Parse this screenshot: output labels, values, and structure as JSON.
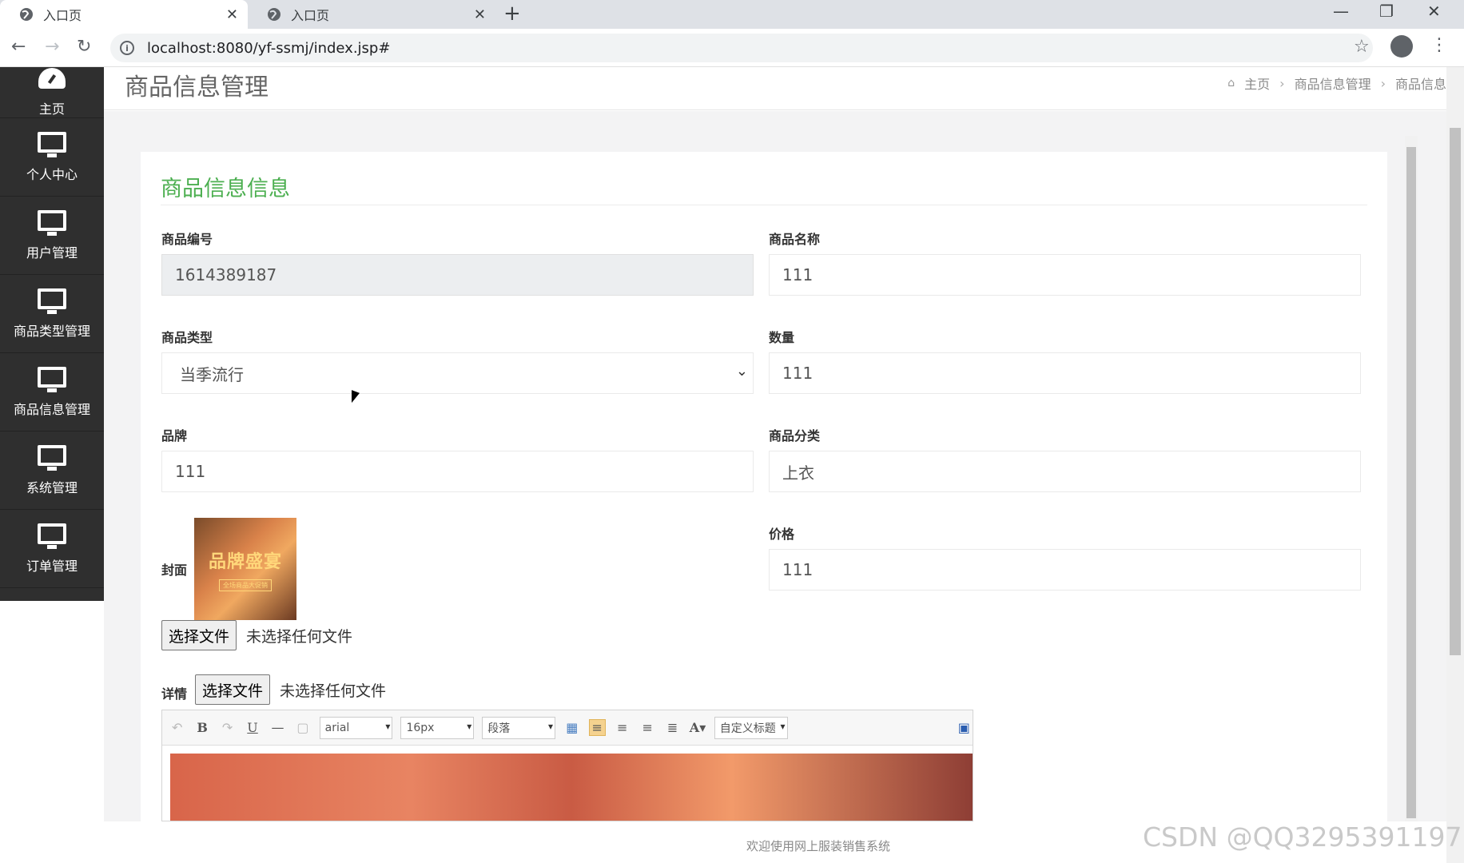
{
  "browser": {
    "tabs": [
      {
        "title": "入口页",
        "active": true
      },
      {
        "title": "入口页",
        "active": false
      }
    ],
    "url": "localhost:8080/yf-ssmj/index.jsp#"
  },
  "sidebar": {
    "items": [
      {
        "label": "主页",
        "icon": "dashboard-icon"
      },
      {
        "label": "个人中心",
        "icon": "monitor-icon"
      },
      {
        "label": "用户管理",
        "icon": "monitor-icon"
      },
      {
        "label": "商品类型管理",
        "icon": "monitor-icon"
      },
      {
        "label": "商品信息管理",
        "icon": "monitor-icon"
      },
      {
        "label": "系统管理",
        "icon": "monitor-icon"
      },
      {
        "label": "订单管理",
        "icon": "monitor-icon"
      }
    ]
  },
  "header": {
    "title": "商品信息管理",
    "breadcrumb": [
      "主页",
      "商品信息管理",
      "商品信息"
    ]
  },
  "form": {
    "title": "商品信息信息",
    "fields": {
      "code": {
        "label": "商品编号",
        "value": "1614389187"
      },
      "name": {
        "label": "商品名称",
        "value": "111"
      },
      "type": {
        "label": "商品类型",
        "value": "当季流行"
      },
      "quantity": {
        "label": "数量",
        "value": "111"
      },
      "brand": {
        "label": "品牌",
        "value": "111"
      },
      "category": {
        "label": "商品分类",
        "value": "上衣"
      },
      "cover": {
        "label": "封面",
        "image_text": "品牌盛宴",
        "image_subtext": "全场商品大促销"
      },
      "price": {
        "label": "价格",
        "value": "111"
      },
      "details": {
        "label": "详情"
      }
    },
    "file_button": "选择文件",
    "file_none": "未选择任何文件",
    "editor": {
      "font": "arial",
      "size": "16px",
      "paragraph": "段落",
      "custom_title": "自定义标题"
    }
  },
  "footer": {
    "text": "欢迎使用网上服装销售系统"
  },
  "watermark": "CSDN @QQ3295391197"
}
